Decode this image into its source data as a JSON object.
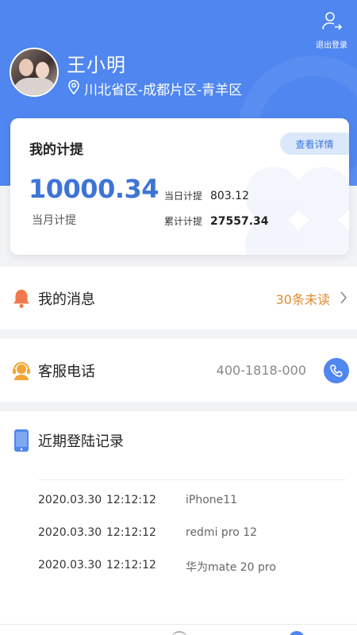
{
  "header": {
    "logout_label": "退出登录",
    "user_name": "王小明",
    "location": "川北省区-成都片区-青羊区",
    "bg_color": "#4f86ef"
  },
  "commission_card": {
    "title": "我的计提",
    "detail_button": "查看详情",
    "month_amount": "10000.34",
    "month_label": "当月计提",
    "today_label": "当日计提",
    "today_value": "803.12",
    "total_label": "累计计提",
    "total_value": "27557.34",
    "accent_color": "#3d74d6"
  },
  "messages": {
    "title": "我的消息",
    "unread": "30条未读",
    "icon": "bell-icon",
    "unread_color": "#e38b2f"
  },
  "service": {
    "title": "客服电话",
    "phone": "400-1818-000",
    "icon": "headset-icon",
    "action_icon": "phone-icon"
  },
  "login_records": {
    "title": "近期登陆记录",
    "icon": "mobile-icon",
    "items": [
      {
        "date": "2020.03.30",
        "time": "12:12:12",
        "device": "iPhone11"
      },
      {
        "date": "2020.03.30",
        "time": "12:12:12",
        "device": "redmi pro 12"
      },
      {
        "date": "2020.03.30",
        "time": "12:12:12",
        "device": "华为mate 20 pro"
      }
    ]
  }
}
